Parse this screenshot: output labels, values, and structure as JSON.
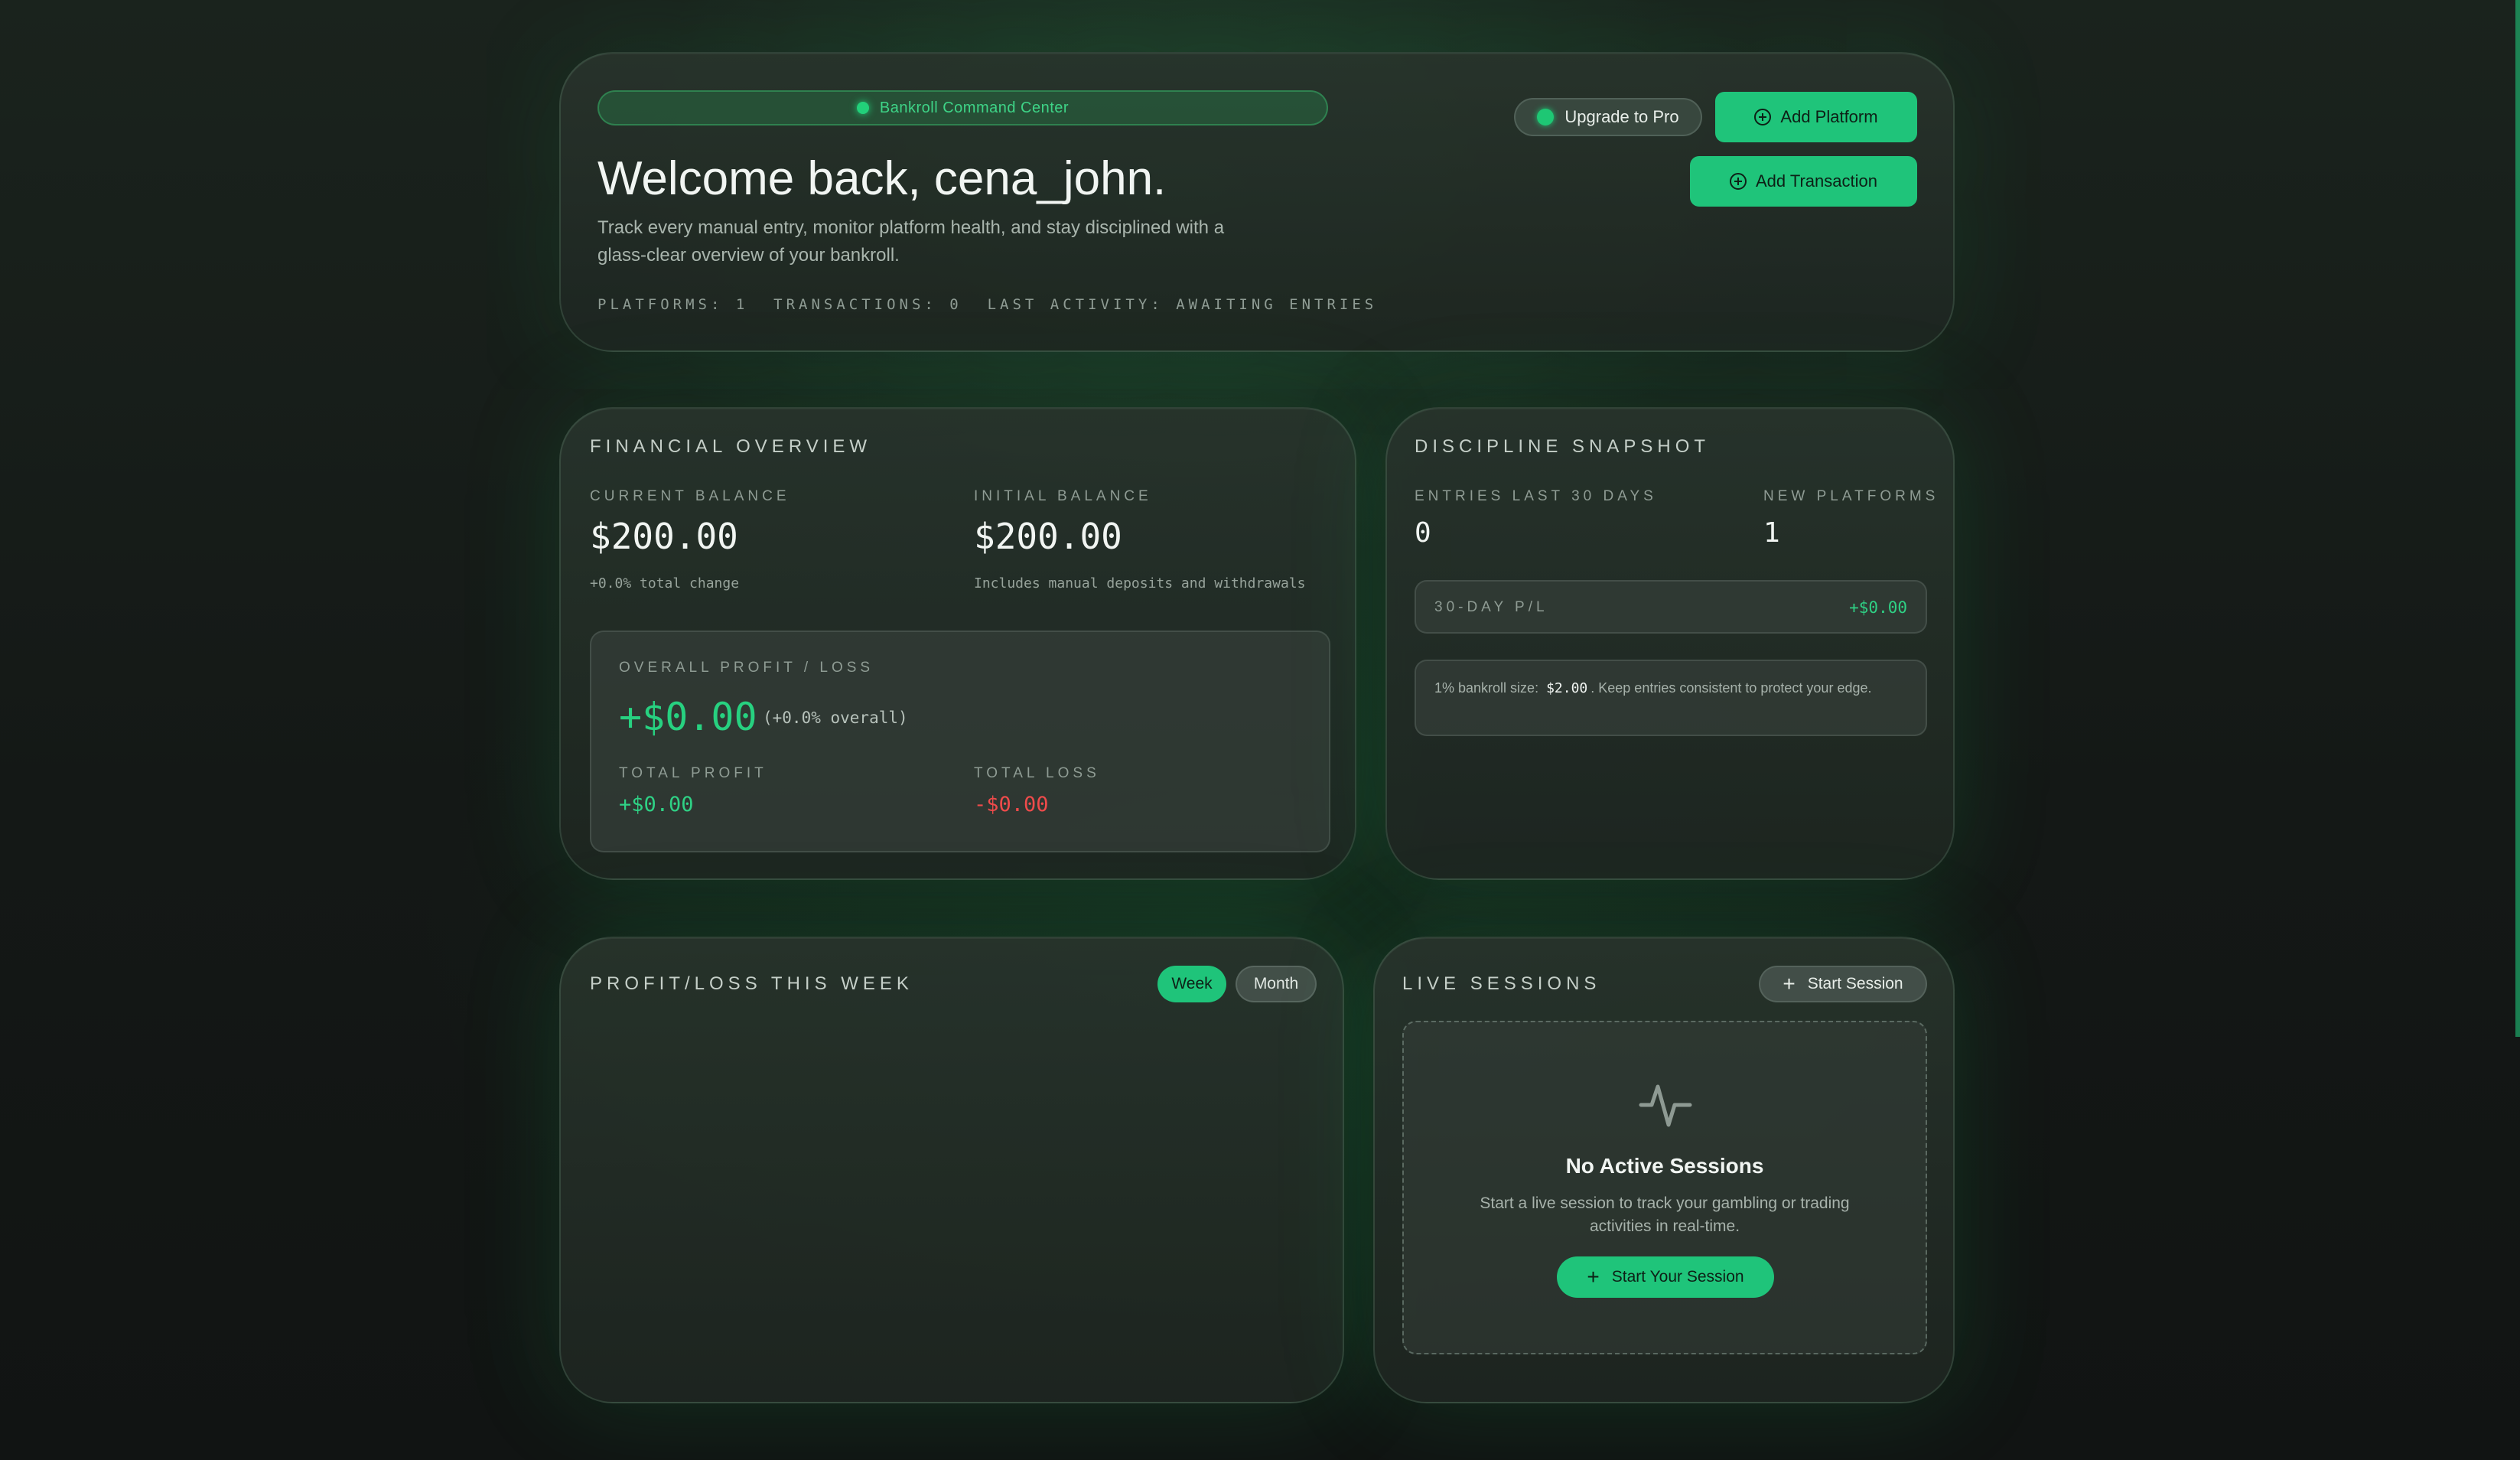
{
  "header": {
    "tag": "Bankroll Command Center",
    "welcome": "Welcome back, cena_john.",
    "subtitle": "Track every manual entry, monitor platform health, and stay disciplined with a glass-clear overview of your bankroll.",
    "stats": "PLATFORMS: 1  TRANSACTIONS: 0  LAST ACTIVITY: AWAITING ENTRIES",
    "upgrade_label": "Upgrade to Pro",
    "add_platform_label": "Add Platform",
    "add_transaction_label": "Add Transaction"
  },
  "financial": {
    "title": "FINANCIAL OVERVIEW",
    "current_balance_label": "CURRENT BALANCE",
    "current_balance": "$200.00",
    "current_change": "+0.0% total change",
    "initial_balance_label": "INITIAL BALANCE",
    "initial_balance": "$200.00",
    "initial_note": "Includes manual deposits and withdrawals",
    "overall_label": "OVERALL PROFIT / LOSS",
    "overall_value": "+$0.00",
    "overall_pct": "(+0.0% overall)",
    "total_profit_label": "TOTAL PROFIT",
    "total_profit": "+$0.00",
    "total_loss_label": "TOTAL LOSS",
    "total_loss": "-$0.00"
  },
  "discipline": {
    "title": "DISCIPLINE SNAPSHOT",
    "entries_label": "ENTRIES LAST 30 DAYS",
    "entries_value": "0",
    "platforms_label": "NEW PLATFORMS",
    "platforms_value": "1",
    "pl_label": "30-DAY P/L",
    "pl_value": "+$0.00",
    "tip_prefix": "1% bankroll size:",
    "tip_amount": "$2.00",
    "tip_suffix": ". Keep entries consistent to protect your edge."
  },
  "chart_panel": {
    "title": "PROFIT/LOSS THIS WEEK",
    "week_label": "Week",
    "month_label": "Month"
  },
  "sessions": {
    "title": "LIVE SESSIONS",
    "start_label": "Start Session",
    "empty_title": "No Active Sessions",
    "empty_desc": "Start a live session to track your gambling or trading activities in real-time.",
    "start_your_label": "Start Your Session"
  },
  "chart_data": {
    "type": "bar",
    "categories": [],
    "values": [],
    "title": "PROFIT/LOSS THIS WEEK"
  },
  "colors": {
    "accent": "#1fc47a",
    "profit": "#2fd185",
    "loss": "#ef4b4b"
  }
}
